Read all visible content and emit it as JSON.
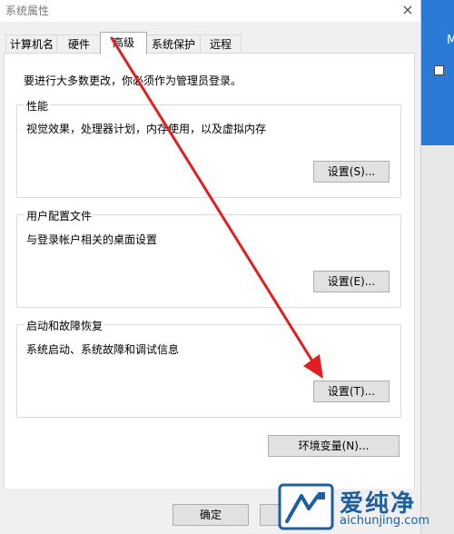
{
  "window": {
    "title": "系统属性",
    "close_glyph": "×"
  },
  "tabs": [
    {
      "label": "计算机名",
      "active": false
    },
    {
      "label": "硬件",
      "active": false
    },
    {
      "label": "高级",
      "active": true
    },
    {
      "label": "系统保护",
      "active": false
    },
    {
      "label": "远程",
      "active": false
    }
  ],
  "advanced": {
    "notice": "要进行大多数更改，你必须作为管理员登录。",
    "performance": {
      "label": "性能",
      "description": "视觉效果，处理器计划，内存使用，以及虚拟内存",
      "button": "设置(S)..."
    },
    "user_profiles": {
      "label": "用户配置文件",
      "description": "与登录帐户相关的桌面设置",
      "button": "设置(E)..."
    },
    "startup_recovery": {
      "label": "启动和故障恢复",
      "description": "系统启动、系统故障和调试信息",
      "button": "设置(T)..."
    },
    "env_button": "环境变量(N)..."
  },
  "footer": {
    "ok_label": "确定"
  },
  "background_window": {
    "letter": "M"
  },
  "watermark": {
    "main_text": "爱纯净",
    "sub_text": "aichunjing.com"
  },
  "colors": {
    "arrow": "#e02020",
    "accent_blue": "#2b7ad6",
    "watermark": "#1d5fa0"
  }
}
